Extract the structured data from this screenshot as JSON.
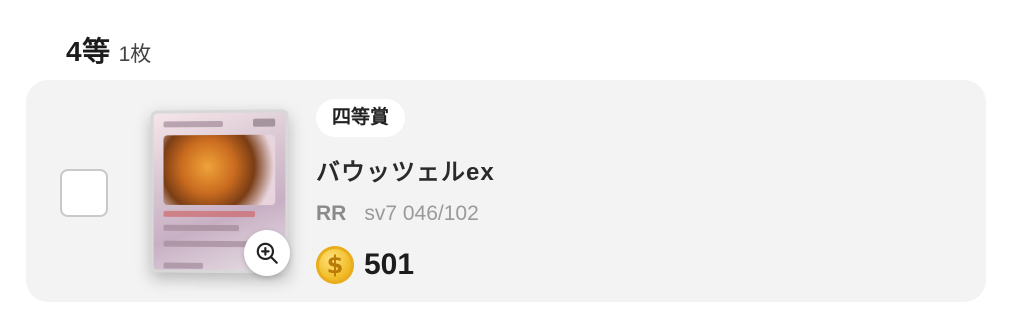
{
  "section": {
    "tier": "4等",
    "count": "1枚"
  },
  "item": {
    "badge": "四等賞",
    "name": "バウッツェルex",
    "rarity": "RR",
    "set_code": "sv7 046/102",
    "price": "501",
    "coin_glyph": "$",
    "checked": false
  },
  "icons": {
    "zoom": "zoom-in-icon",
    "coin": "coin-icon"
  },
  "colors": {
    "card_bg": "#f3f3f3",
    "coin": "#f2bd2a",
    "muted": "#9a9a9a"
  }
}
